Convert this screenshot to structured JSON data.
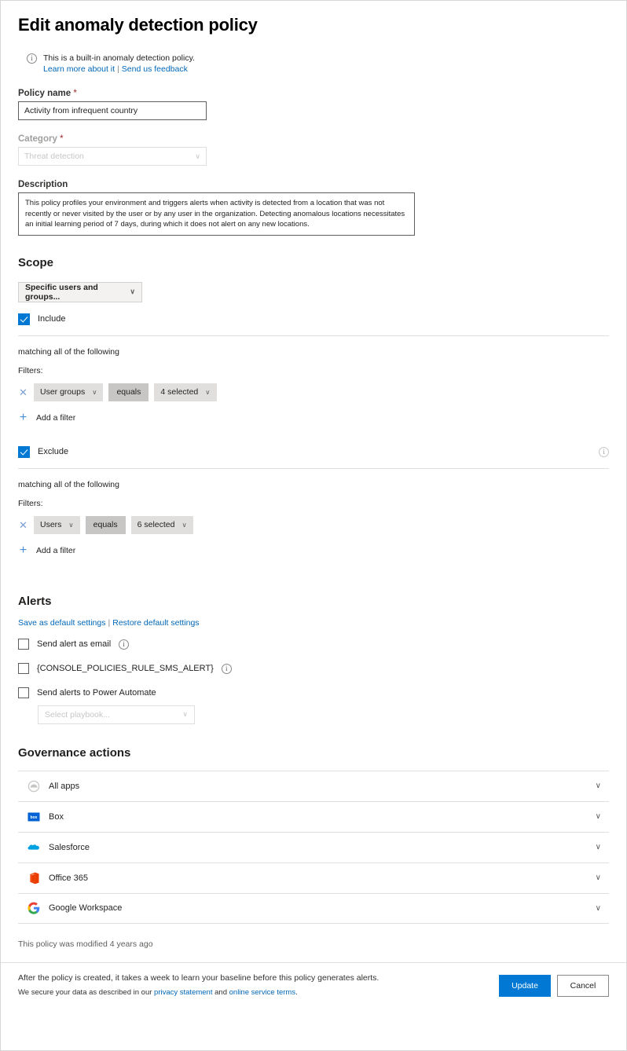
{
  "page": {
    "title": "Edit anomaly detection policy"
  },
  "notice": {
    "icon": "info-circle-icon",
    "text": "This is a built-in anomaly detection policy.",
    "learn_more": "Learn more about it",
    "divider": "|",
    "feedback": "Send us feedback"
  },
  "policy_name": {
    "label": "Policy name",
    "required_mark": "*",
    "value": "Activity from infrequent country"
  },
  "category": {
    "label": "Category",
    "required_mark": "*",
    "value": "Threat detection",
    "chevron": "∨"
  },
  "description": {
    "label": "Description",
    "value": "This policy profiles your environment and triggers alerts when activity is detected from a location that was not recently or never visited by the user or by any user in the organization. Detecting anomalous locations necessitates an initial learning period of 7 days, during which it does not alert on any new locations."
  },
  "scope": {
    "heading": "Scope",
    "selector_value": "Specific users and groups...",
    "chevron": "∨",
    "include": {
      "label": "Include",
      "checked": true,
      "matching_text": "matching all of the following",
      "filters_label": "Filters:",
      "filters": [
        {
          "remove": "✕",
          "field": "User groups",
          "operator": "equals",
          "value": "4 selected",
          "chevron": "∨"
        }
      ],
      "add_filter": "Add a filter",
      "plus": "+"
    },
    "exclude": {
      "label": "Exclude",
      "checked": true,
      "info_icon": "info-circle-icon",
      "matching_text": "matching all of the following",
      "filters_label": "Filters:",
      "filters": [
        {
          "remove": "✕",
          "field": "Users",
          "operator": "equals",
          "value": "6 selected",
          "chevron": "∨"
        }
      ],
      "add_filter": "Add a filter",
      "plus": "+"
    }
  },
  "alerts": {
    "heading": "Alerts",
    "save_default": "Save as default settings",
    "divider": "|",
    "restore_default": "Restore default settings",
    "options": [
      {
        "label": "Send alert as email",
        "checked": false,
        "info": true
      },
      {
        "label": "{CONSOLE_POLICIES_RULE_SMS_ALERT}",
        "checked": false,
        "info": true
      },
      {
        "label": "Send alerts to Power Automate",
        "checked": false,
        "info": false
      }
    ],
    "playbook": {
      "placeholder": "Select playbook...",
      "chevron": "∨"
    }
  },
  "governance": {
    "heading": "Governance actions",
    "rows": [
      {
        "name": "All apps",
        "icon": "all-apps-icon",
        "chevron": "∨"
      },
      {
        "name": "Box",
        "icon": "box-icon",
        "chevron": "∨"
      },
      {
        "name": "Salesforce",
        "icon": "salesforce-icon",
        "chevron": "∨"
      },
      {
        "name": "Office 365",
        "icon": "office365-icon",
        "chevron": "∨"
      },
      {
        "name": "Google Workspace",
        "icon": "google-workspace-icon",
        "chevron": "∨"
      }
    ]
  },
  "footer": {
    "modified": "This policy was modified 4 years ago",
    "note_line1": "After the policy is created, it takes a week to learn your baseline before this policy generates alerts.",
    "note_line2_pre": "We secure your data as described in our ",
    "privacy_link": "privacy statement",
    "note_line2_mid": " and ",
    "terms_link": "online service terms",
    "note_line2_post": ".",
    "update_button": "Update",
    "cancel_button": "Cancel"
  },
  "colors": {
    "accent": "#0078d4",
    "link": "#0067b8",
    "required": "#a4262c"
  }
}
